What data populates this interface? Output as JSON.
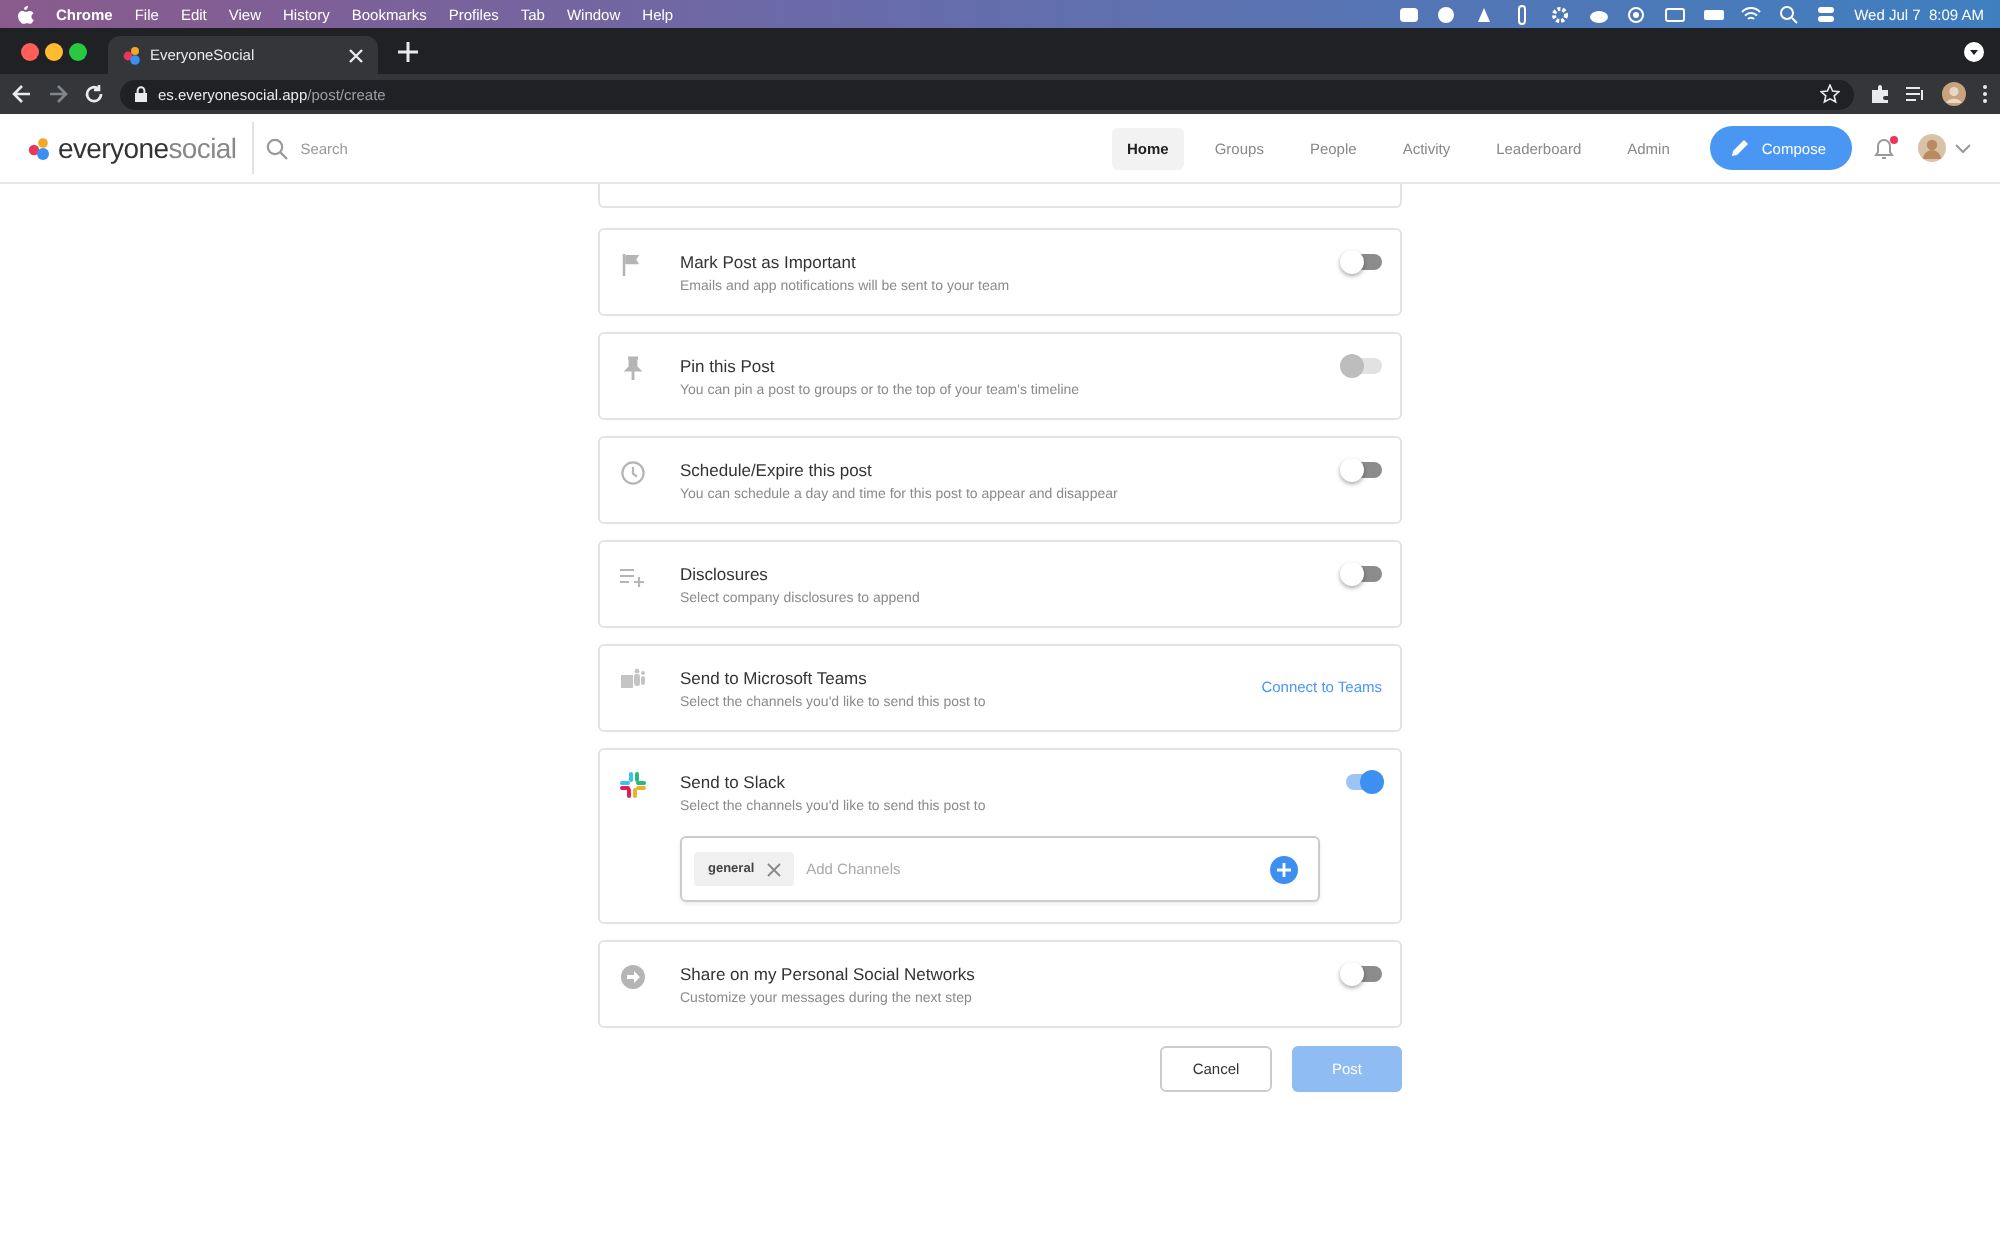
{
  "menu_bar": {
    "app": "Chrome",
    "items": [
      "File",
      "Edit",
      "View",
      "History",
      "Bookmarks",
      "Profiles",
      "Tab",
      "Window",
      "Help"
    ],
    "clock": "Wed Jul 7  8:09 AM"
  },
  "browser": {
    "tab": {
      "title": "EveryoneSocial"
    },
    "address": {
      "host": "es.everyonesocial.app",
      "path": "/post/create"
    }
  },
  "app_nav": {
    "logo": {
      "text_1": "everyone",
      "text_2": "social"
    },
    "search": {
      "placeholder": "Search"
    },
    "links": [
      {
        "label": "Home",
        "selected": true
      },
      {
        "label": "Groups",
        "selected": false
      },
      {
        "label": "People",
        "selected": false
      },
      {
        "label": "Activity",
        "selected": false
      },
      {
        "label": "Leaderboard",
        "selected": false
      },
      {
        "label": "Admin",
        "selected": false
      }
    ],
    "compose": "Compose",
    "notifications_unread": true
  },
  "settings": [
    {
      "kind": "toggle",
      "title": "Mark Post as Important",
      "description": "Emails and app notifications will be sent to your team",
      "on": false,
      "disabled": false
    },
    {
      "kind": "toggle",
      "title": "Pin this Post",
      "description": "You can pin a post to groups or to the top of your team's timeline",
      "on": false,
      "disabled": true
    },
    {
      "kind": "toggle",
      "title": "Schedule/Expire this post",
      "description": "You can schedule a day and time for this post to appear and disappear",
      "on": false,
      "disabled": false
    },
    {
      "kind": "toggle",
      "title": "Disclosures",
      "description": "Select company disclosures to append",
      "on": false,
      "disabled": false
    },
    {
      "kind": "link",
      "title": "Send to Microsoft Teams",
      "description": "Select the channels you'd like to send this post to",
      "link": "Connect to Teams"
    },
    {
      "kind": "toggle",
      "title": "Send to Slack",
      "description": "Select the channels you'd like to send this post to",
      "on": true,
      "disabled": false,
      "channels_field": {
        "tags": [
          "general"
        ],
        "placeholder": "Add Channels"
      }
    },
    {
      "kind": "toggle",
      "title": "Share on my Personal Social Networks",
      "description": "Customize your messages during the next step",
      "on": false,
      "disabled": false
    }
  ],
  "actions": {
    "cancel": "Cancel",
    "post": {
      "label": "Post",
      "disabled": true
    }
  }
}
